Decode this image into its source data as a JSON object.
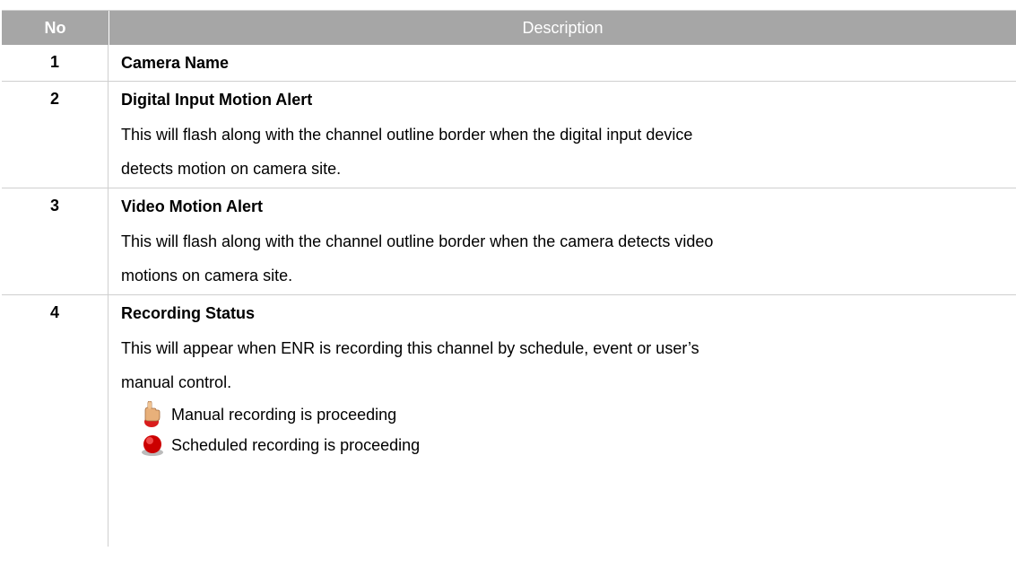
{
  "header": {
    "no": "No",
    "description": "Description"
  },
  "rows": [
    {
      "no": "1",
      "title": "Camera Name",
      "lines": []
    },
    {
      "no": "2",
      "title": "Digital Input Motion Alert",
      "lines": [
        "This will flash along with the channel outline border when the digital input device",
        "detects motion on camera site."
      ]
    },
    {
      "no": "3",
      "title": "Video Motion Alert",
      "lines": [
        "This will flash along with the channel outline border when the camera detects video",
        "motions on camera site."
      ]
    },
    {
      "no": "4",
      "title": "Recording Status",
      "lines": [
        "This will appear when ENR is recording this channel by schedule, event or user’s",
        "manual control."
      ],
      "icon_items": [
        {
          "icon": "hand-pointer-record-icon",
          "text": "Manual recording is proceeding"
        },
        {
          "icon": "red-record-dot-icon",
          "text": "Scheduled recording is proceeding"
        }
      ]
    }
  ],
  "colors": {
    "header_bg": "#a6a6a6",
    "header_text": "#ffffff",
    "border": "#cfcfcf"
  }
}
